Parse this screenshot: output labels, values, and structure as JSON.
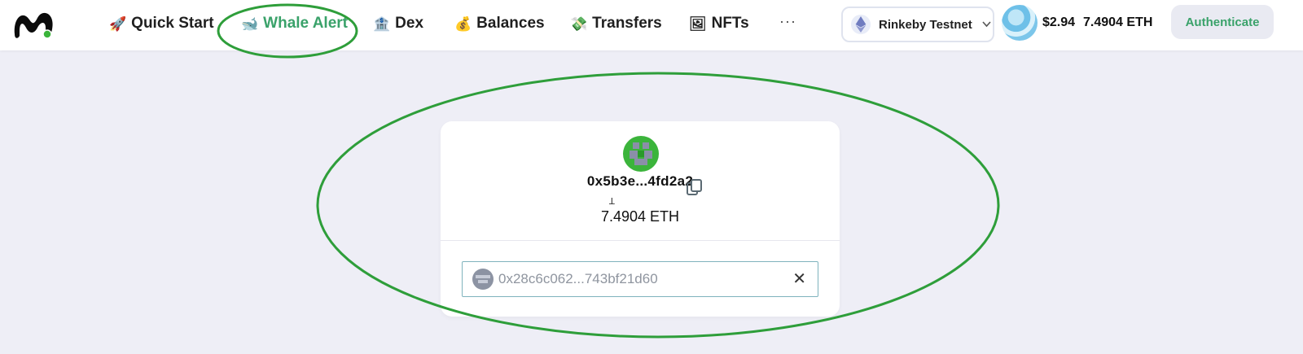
{
  "header": {
    "nav": [
      {
        "icon": "rocket-icon",
        "glyph": "🚀",
        "label": "Quick Start",
        "active": false
      },
      {
        "icon": "whale-icon",
        "glyph": "🐋",
        "label": "Whale Alert",
        "active": true
      },
      {
        "icon": "bank-icon",
        "glyph": "🏦",
        "label": "Dex",
        "active": false
      },
      {
        "icon": "money-bag-icon",
        "glyph": "💰",
        "label": "Balances",
        "active": false
      },
      {
        "icon": "money-wings-icon",
        "glyph": "💸",
        "label": "Transfers",
        "active": false
      },
      {
        "icon": "picture-icon",
        "glyph": "🖼",
        "label": "NFTs",
        "active": false
      }
    ],
    "more": "···",
    "network": {
      "icon": "ethereum-icon",
      "label": "Rinkeby Testnet"
    },
    "balance_usd": "$2.94",
    "balance_eth": "7.4904 ETH",
    "auth_label": "Authenticate"
  },
  "card": {
    "address": "0x5b3e...4fd2a2",
    "balance": "7.4904 ETH",
    "cursor": "ꓕ",
    "input_value": "0x28c6c062...743bf21d60",
    "clear": "✕"
  },
  "colors": {
    "accent": "#3aa26a",
    "annotation": "#2e9e3a",
    "page_bg": "#eeeef6"
  }
}
